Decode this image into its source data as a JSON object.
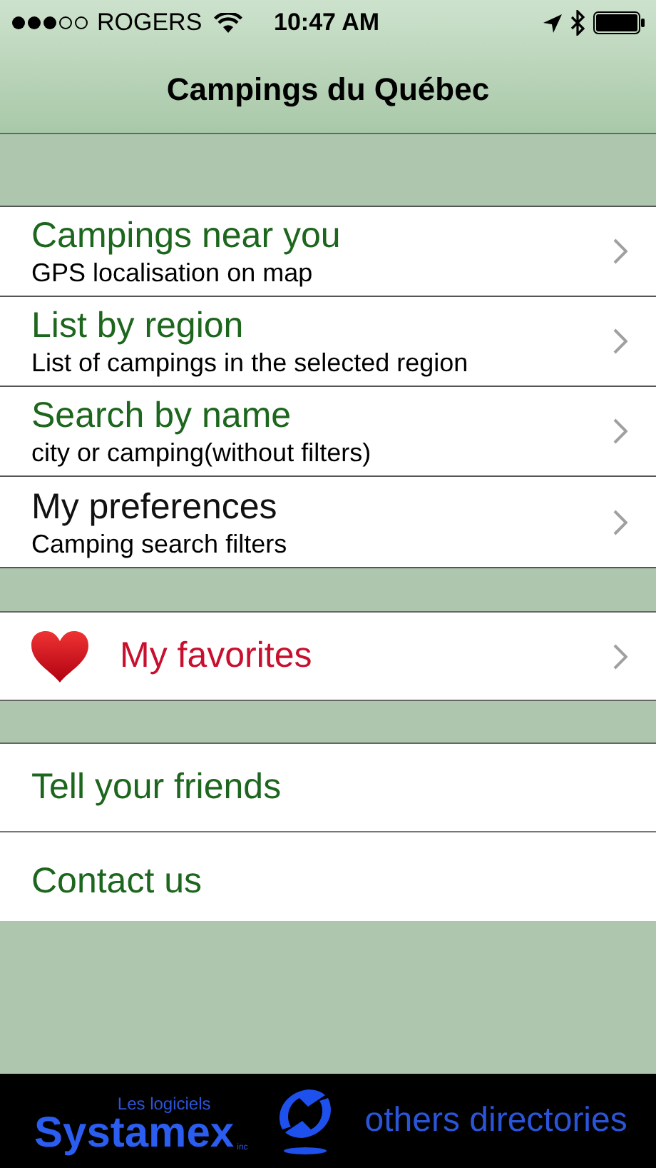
{
  "status_bar": {
    "carrier": "ROGERS",
    "time": "10:47 AM"
  },
  "nav_bar": {
    "title": "Campings du Québec"
  },
  "menu": [
    {
      "title": "Campings near you",
      "subtitle": "GPS localisation on map",
      "color": "#1d661d"
    },
    {
      "title": "List by region",
      "subtitle": "List of campings in the selected region",
      "color": "#1d661d"
    },
    {
      "title": "Search by name",
      "subtitle": "city or camping(without filters)",
      "color": "#1d661d"
    },
    {
      "title": "My preferences",
      "subtitle": "Camping search filters",
      "color": "#111111"
    }
  ],
  "favorites": {
    "title": "My favorites"
  },
  "links": [
    {
      "title": "Tell your friends"
    },
    {
      "title": "Contact us"
    }
  ],
  "footer": {
    "logo_small": "Les logiciels",
    "logo_big": "Systamex",
    "logo_suffix": "inc",
    "link": "others directories"
  }
}
